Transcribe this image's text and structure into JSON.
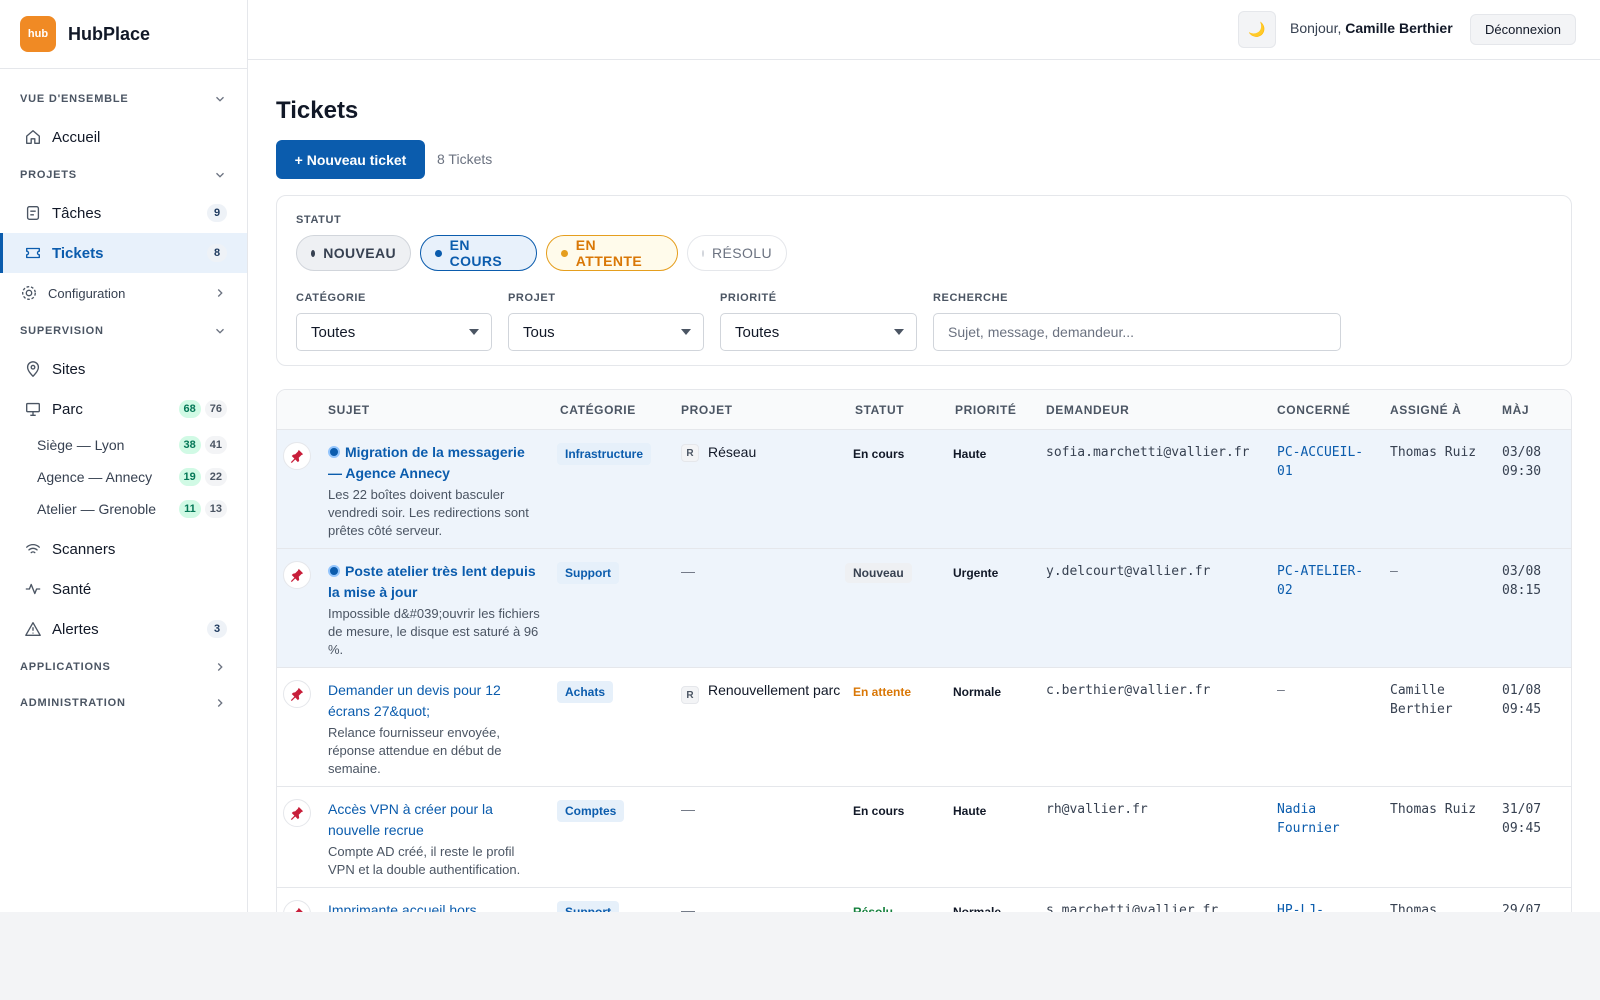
{
  "brand": {
    "logo_text": "hub",
    "name": "HubPlace"
  },
  "sidebar": {
    "overview": {
      "title": "VUE D'ENSEMBLE",
      "home": "Accueil"
    },
    "projects": {
      "title": "PROJETS",
      "tasks": {
        "label": "Tâches",
        "count": "9"
      },
      "tickets": {
        "label": "Tickets",
        "count": "8"
      },
      "config": "Configuration"
    },
    "supervision": {
      "title": "SUPERVISION",
      "sites": "Sites",
      "parc": {
        "label": "Parc",
        "ok": "68",
        "total": "76"
      },
      "sub": [
        {
          "label": "Siège — Lyon",
          "ok": "38",
          "total": "41"
        },
        {
          "label": "Agence — Annecy",
          "ok": "19",
          "total": "22"
        },
        {
          "label": "Atelier — Grenoble",
          "ok": "11",
          "total": "13"
        }
      ],
      "scanners": "Scanners",
      "health": "Santé",
      "alerts": {
        "label": "Alertes",
        "count": "3"
      }
    },
    "applications": "APPLICATIONS",
    "administration": "ADMINISTRATION"
  },
  "topbar": {
    "theme_glyph": "🌙",
    "greeting": "Bonjour,",
    "user": "Camille Berthier",
    "logout": "Déconnexion"
  },
  "page": {
    "title": "Tickets",
    "new_ticket": "+ Nouveau ticket",
    "count": "8 Tickets"
  },
  "filters": {
    "status_label": "STATUT",
    "statuses": [
      "NOUVEAU",
      "EN COURS",
      "EN ATTENTE",
      "RÉSOLU"
    ],
    "category": {
      "label": "CATÉGORIE",
      "value": "Toutes"
    },
    "project": {
      "label": "PROJET",
      "value": "Tous"
    },
    "priority": {
      "label": "PRIORITÉ",
      "value": "Toutes"
    },
    "search": {
      "label": "RECHERCHE",
      "placeholder": "Sujet, message, demandeur..."
    }
  },
  "table": {
    "headers": [
      "SUJET",
      "CATÉGORIE",
      "PROJET",
      "STATUT",
      "PRIORITÉ",
      "DEMANDEUR",
      "CONCERNÉ",
      "ASSIGNÉ À",
      "MÀJ"
    ],
    "rows": [
      {
        "title": "Migration de la messagerie — Agence Annecy",
        "desc": "Les 22 boîtes doivent basculer vendredi soir. Les redirections sont prêtes côté serveur.",
        "category": "Infrastructure",
        "project_badge": "R",
        "project": "Réseau",
        "status": "En cours",
        "priority": "Haute",
        "requester": "sofia.marchetti@vallier.fr",
        "concerned": "PC-ACCUEIL-01",
        "assigned": "Thomas Ruiz",
        "updated": "03/08 09:30"
      },
      {
        "title": "Poste atelier très lent depuis la mise à jour",
        "desc": "Impossible d&#039;ouvrir les fichiers de mesure, le disque est saturé à 96 %.",
        "category": "Support",
        "project": "—",
        "status": "Nouveau",
        "priority": "Urgente",
        "requester": "y.delcourt@vallier.fr",
        "concerned": "PC-ATELIER-02",
        "assigned": "—",
        "updated": "03/08 08:15"
      },
      {
        "title": "Demander un devis pour 12 écrans 27&quot;",
        "desc": "Relance fournisseur envoyée, réponse attendue en début de semaine.",
        "category": "Achats",
        "project_badge": "R",
        "project": "Renouvellement parc",
        "status": "En attente",
        "priority": "Normale",
        "requester": "c.berthier@vallier.fr",
        "concerned": "—",
        "assigned": "Camille Berthier",
        "updated": "01/08 09:45"
      },
      {
        "title": "Accès VPN à créer pour la nouvelle recrue",
        "desc": "Compte AD créé, il reste le profil VPN et la double authentification.",
        "category": "Comptes",
        "project": "—",
        "status": "En cours",
        "priority": "Haute",
        "requester": "rh@vallier.fr",
        "concerned": "Nadia Fournier",
        "assigned": "Thomas Ruiz",
        "updated": "31/07 09:45"
      },
      {
        "title": "Imprimante accueil hors",
        "category": "Support",
        "project": "—",
        "status": "Résolu",
        "priority": "Normale",
        "requester": "s.marchetti@vallier.fr",
        "concerned": "HP-LJ-",
        "assigned": "Thomas",
        "updated": "29/07"
      }
    ]
  }
}
